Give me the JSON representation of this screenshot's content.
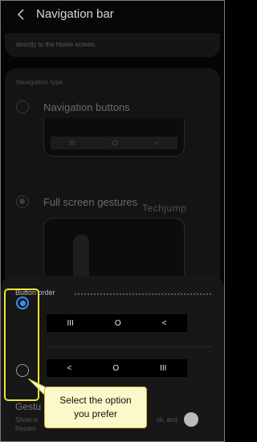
{
  "header": {
    "title": "Navigation bar"
  },
  "top_card": {
    "text": "directly to the Home screen."
  },
  "navigation_type": {
    "section_label": "Navigation type",
    "option_buttons": "Navigation buttons",
    "option_gestures": "Full screen gestures",
    "preview_buttons": {
      "recents_glyph": "III",
      "home_glyph": "O",
      "back_glyph": "<"
    }
  },
  "button_order": {
    "section_label": "Button order",
    "option_1": {
      "recents_glyph": "III",
      "home_glyph": "O",
      "back_glyph": "<"
    },
    "option_2": {
      "back_glyph": "<",
      "home_glyph": "O",
      "recents_glyph": "III"
    }
  },
  "gesture_hints": {
    "title": "Gestu",
    "description_line1": "Show w",
    "description_line1_end": "ck, and",
    "description_line2": "Recent"
  },
  "callout": {
    "line1": "Select the option",
    "line2": "you prefer"
  },
  "watermark": {
    "text": "Techjump"
  },
  "colors": {
    "accent_blue": "#3a8ef0",
    "highlight_yellow": "#f0e23c",
    "callout_bg": "#fbf9c9"
  }
}
